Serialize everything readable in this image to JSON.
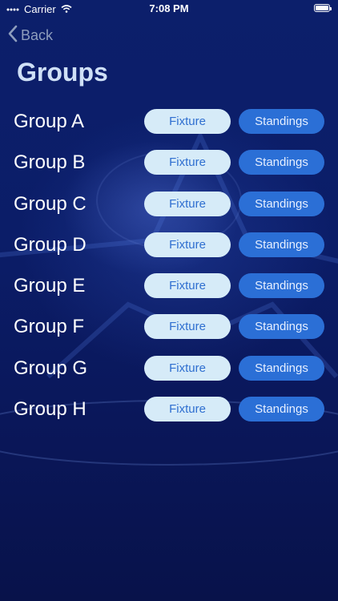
{
  "status_bar": {
    "carrier": "Carrier",
    "time": "7:08 PM"
  },
  "nav": {
    "back_label": "Back"
  },
  "page": {
    "title": "Groups"
  },
  "buttons": {
    "fixture_label": "Fixture",
    "standings_label": "Standings"
  },
  "groups": [
    {
      "name": "Group A"
    },
    {
      "name": "Group B"
    },
    {
      "name": "Group C"
    },
    {
      "name": "Group D"
    },
    {
      "name": "Group E"
    },
    {
      "name": "Group F"
    },
    {
      "name": "Group G"
    },
    {
      "name": "Group H"
    }
  ],
  "colors": {
    "background": "#0b1a5e",
    "title": "#cfe0f7",
    "fixture_button_bg": "#d6ebf8",
    "fixture_button_text": "#2f6fd0",
    "standings_button_bg": "#2b6fd6",
    "standings_button_text": "#e6efff"
  }
}
